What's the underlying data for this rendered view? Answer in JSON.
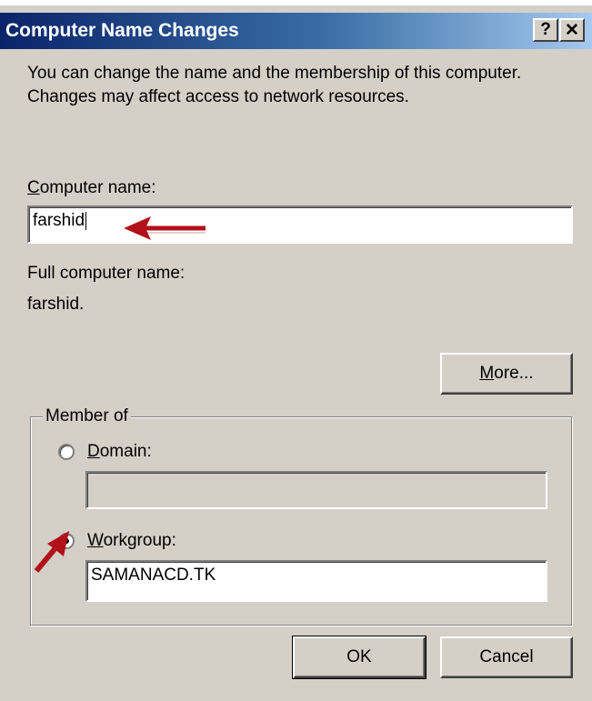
{
  "window": {
    "title": "Computer Name Changes"
  },
  "titlebar_buttons": {
    "help": "?",
    "close": "✕"
  },
  "intro": {
    "text": "You can change the name and the membership of this computer. Changes may affect access to network resources."
  },
  "computer_name": {
    "label_accel": "C",
    "label_rest": "omputer name:",
    "value": "farshid"
  },
  "full_name": {
    "label": "Full computer name:",
    "value": "farshid."
  },
  "more_button": {
    "label_accel": "M",
    "label_rest": "ore..."
  },
  "member_of": {
    "legend": "Member of",
    "domain": {
      "label_accel": "D",
      "label_rest": "omain:",
      "value": "",
      "selected": false
    },
    "workgroup": {
      "label_accel": "W",
      "label_rest": "orkgroup:",
      "value": "SAMANACD.TK",
      "selected": true
    }
  },
  "buttons": {
    "ok": "OK",
    "cancel": "Cancel"
  },
  "colors": {
    "dialog_bg": "#d4d0c8",
    "title_start": "#0a246a",
    "title_end": "#a6caf0",
    "annotation_arrow": "#b3111a"
  }
}
